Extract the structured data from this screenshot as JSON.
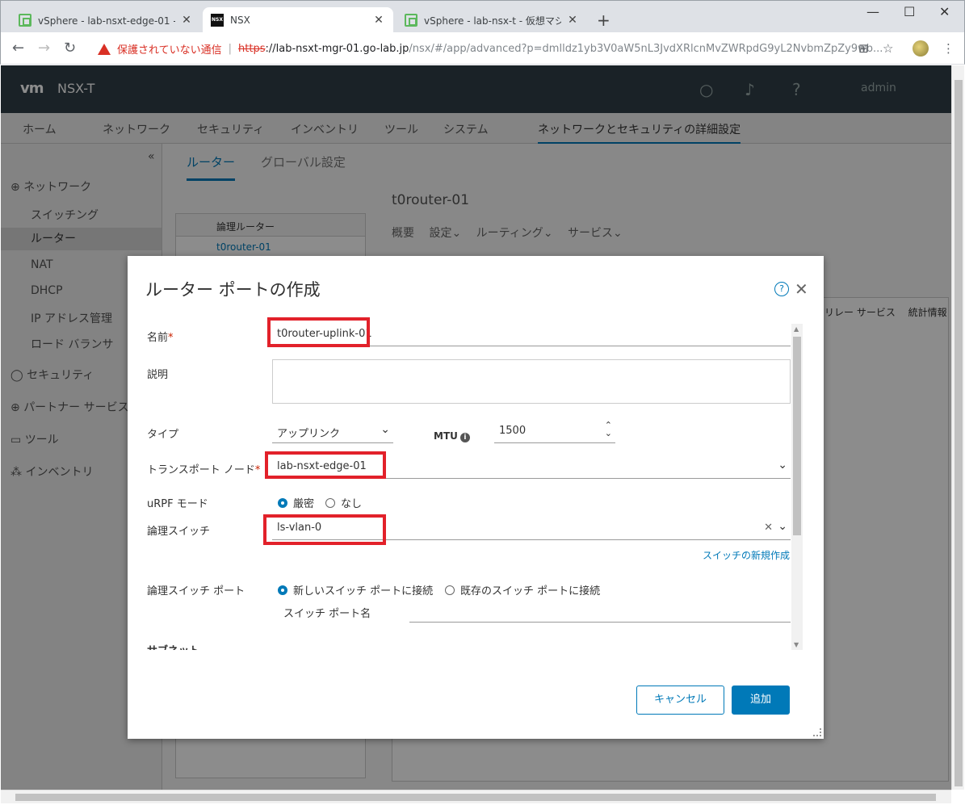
{
  "browser": {
    "tabs": [
      {
        "title": "vSphere - lab-nsxt-edge-01 - サマ",
        "favicon": "vsphere-icon",
        "active": false
      },
      {
        "title": "NSX",
        "favicon": "nsx-icon",
        "active": true
      },
      {
        "title": "vSphere - lab-nsx-t - 仮想マシン",
        "favicon": "vsphere-icon",
        "active": false
      }
    ],
    "security_warning": "保護されていない通信",
    "url_scheme": "https",
    "url_host": "://lab-nsxt-mgr-01.go-lab.jp",
    "url_rest": "/nsx/#/app/advanced?p=dmlldz1yb3V0aW5nL3JvdXRlcnMvZWRpdG9yL2NvbmZpZy9wb..."
  },
  "app": {
    "logo": "vm",
    "title": "NSX-T",
    "user": "admin",
    "main_nav": [
      "ホーム",
      "ネットワーク",
      "セキュリティ",
      "インベントリ",
      "ツール",
      "システム",
      "ネットワークとセキュリティの詳細設定"
    ],
    "sidebar": {
      "collapse": "«",
      "items": [
        {
          "label": "ネットワーク",
          "type": "section"
        },
        {
          "label": "スイッチング",
          "type": "item"
        },
        {
          "label": "ルーター",
          "type": "item",
          "active": true
        },
        {
          "label": "NAT",
          "type": "item"
        },
        {
          "label": "DHCP",
          "type": "item"
        },
        {
          "label": "IP アドレス管理",
          "type": "item"
        },
        {
          "label": "ロード バランサ",
          "type": "item"
        },
        {
          "label": "セキュリティ",
          "type": "section"
        },
        {
          "label": "パートナー サービス",
          "type": "section"
        },
        {
          "label": "ツール",
          "type": "section"
        },
        {
          "label": "インベントリ",
          "type": "section"
        }
      ]
    },
    "content_tabs": [
      "ルーター",
      "グローバル設定"
    ],
    "table_header": "論理ルーター",
    "table_row": "t0router-01",
    "detail": {
      "title": "t0router-01",
      "tabs": [
        "概要",
        "設定",
        "ルーティング",
        "サービス"
      ],
      "cols": [
        "リレー サービス",
        "統計情報"
      ]
    }
  },
  "modal": {
    "title": "ルーター ポートの作成",
    "fields": {
      "name_label": "名前",
      "name_value": "t0router-uplink-01",
      "description_label": "説明",
      "type_label": "タイプ",
      "type_value": "アップリンク",
      "mtu_label": "MTU",
      "mtu_value": "1500",
      "transport_node_label": "トランスポート ノード",
      "transport_node_value": "lab-nsxt-edge-01",
      "urpf_label": "uRPF モード",
      "urpf_strict": "厳密",
      "urpf_none": "なし",
      "logical_switch_label": "論理スイッチ",
      "logical_switch_value": "ls-vlan-0",
      "new_switch_link": "スイッチの新規作成",
      "ls_port_label": "論理スイッチ ポート",
      "ls_port_new": "新しいスイッチ ポートに接続",
      "ls_port_existing": "既存のスイッチ ポートに接続",
      "switch_port_name_label": "スイッチ ポート名",
      "subnet_label": "サブネット"
    },
    "cancel_label": "キャンセル",
    "add_label": "追加"
  },
  "colors": {
    "accent": "#0079b8",
    "highlight": "#e2212a",
    "header": "#313f47"
  }
}
